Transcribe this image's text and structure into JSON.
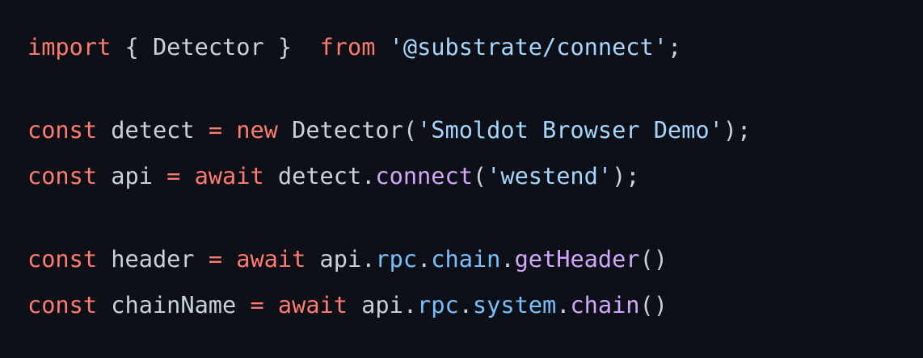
{
  "code": {
    "l1": {
      "t1": "import",
      "t2": " { ",
      "t3": "Detector",
      "t4": " }  ",
      "t5": "from",
      "t6": " ",
      "t7": "'@substrate/connect'",
      "t8": ";"
    },
    "l2": {
      "t1": "const",
      "t2": " detect ",
      "t3": "=",
      "t4": " ",
      "t5": "new",
      "t6": " Detector(",
      "t7": "'Smoldot Browser Demo'",
      "t8": ");"
    },
    "l3": {
      "t1": "const",
      "t2": " api ",
      "t3": "=",
      "t4": " ",
      "t5": "await",
      "t6": " detect.",
      "t7": "connect",
      "t8": "(",
      "t9": "'westend'",
      "t10": ");"
    },
    "l4": {
      "t1": "const",
      "t2": " header ",
      "t3": "=",
      "t4": " ",
      "t5": "await",
      "t6": " api.",
      "t7": "rpc",
      "t8": ".",
      "t9": "chain",
      "t10": ".",
      "t11": "getHeader",
      "t12": "()"
    },
    "l5": {
      "t1": "const",
      "t2": " chainName ",
      "t3": "=",
      "t4": " ",
      "t5": "await",
      "t6": " api.",
      "t7": "rpc",
      "t8": ".",
      "t9": "system",
      "t10": ".",
      "t11": "chain",
      "t12": "()"
    }
  },
  "colors": {
    "background": "#0d1117",
    "keyword": "#ff7b72",
    "string": "#a5d6ff",
    "function": "#d2a8ff",
    "property": "#79c0ff",
    "text": "#c9d1d9"
  }
}
